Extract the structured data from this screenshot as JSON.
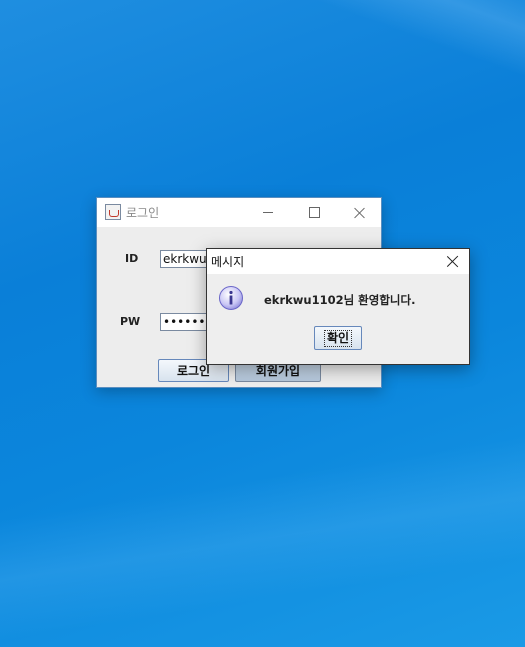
{
  "login_window": {
    "title": "로그인",
    "id_label": "ID",
    "pw_label": "PW",
    "id_value": "ekrkwu1102",
    "pw_value": "••••••••",
    "login_button": "로그인",
    "signup_button": "회원가입"
  },
  "message_dialog": {
    "title": "메시지",
    "message": "ekrkwu1102님 환영합니다.",
    "ok_button": "확인",
    "icon": "info-icon"
  }
}
